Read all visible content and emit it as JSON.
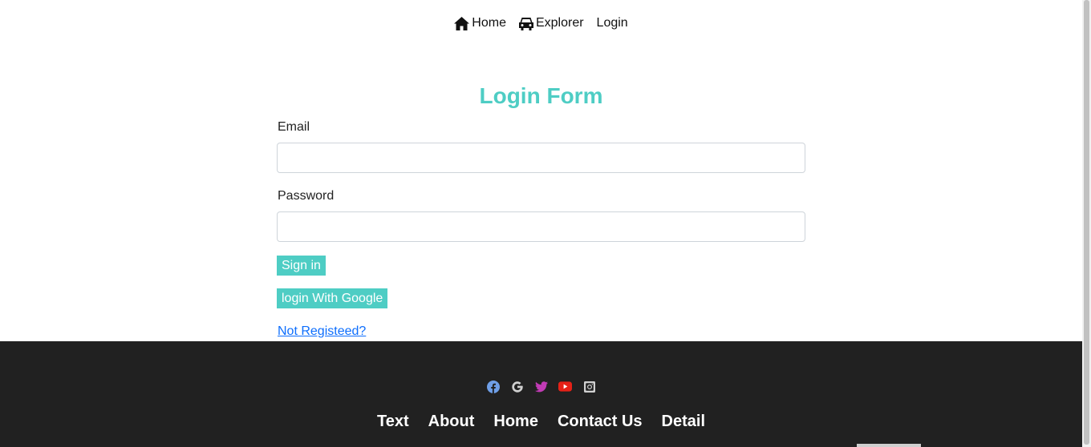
{
  "nav": {
    "items": [
      {
        "label": "Home",
        "icon": "home-icon"
      },
      {
        "label": "Explorer",
        "icon": "car-icon"
      },
      {
        "label": "Login"
      }
    ]
  },
  "form": {
    "title": "Login Form",
    "email_label": "Email",
    "email_value": "",
    "password_label": "Password",
    "password_value": "",
    "sign_in_label": "Sign in",
    "google_label": "login With Google",
    "register_link": "Not Registeed?"
  },
  "footer": {
    "social": [
      {
        "icon": "facebook-icon",
        "color": "#6f9fe8"
      },
      {
        "icon": "google-icon",
        "color": "#d0d0d0"
      },
      {
        "icon": "twitter-icon",
        "color": "#c13bb5"
      },
      {
        "icon": "youtube-icon",
        "color": "#e62117"
      },
      {
        "icon": "instagram-icon",
        "color": "#d0d0d0"
      }
    ],
    "links": [
      "Text",
      "About",
      "Home",
      "Contact Us",
      "Detail"
    ]
  },
  "colors": {
    "accent": "#4ecdc4",
    "footer_bg": "#212121",
    "link": "#0d6efd"
  }
}
